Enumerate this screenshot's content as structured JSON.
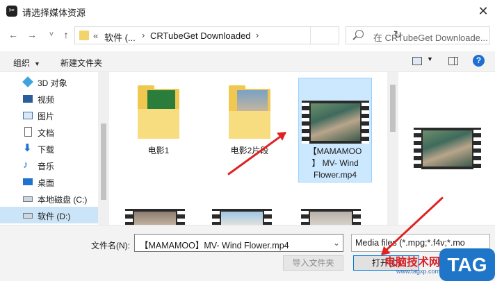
{
  "window": {
    "title": "请选择媒体资源",
    "app_icon_glyph": "✂"
  },
  "nav": {
    "back": "←",
    "forward": "→",
    "down": "˅",
    "up": "↑",
    "address": {
      "prefix": "«",
      "seg1": "软件 (...",
      "seg2": "CRTubeGet Downloaded",
      "chevron": "›"
    },
    "refresh": "↻",
    "search_placeholder": "在 CRTubeGet Downloade..."
  },
  "toolbar": {
    "organize": "组织",
    "new_folder": "新建文件夹",
    "caret": "▼",
    "help": "?"
  },
  "sidebar": {
    "items": [
      {
        "label": "3D 对象",
        "icon": "cube-3d-icon",
        "color": "#3fa3e0"
      },
      {
        "label": "视频",
        "icon": "video-icon",
        "color": "#2b5d9a"
      },
      {
        "label": "图片",
        "icon": "picture-icon",
        "color": "#3b6db3"
      },
      {
        "label": "文档",
        "icon": "document-icon",
        "color": "#6a6a6a"
      },
      {
        "label": "下载",
        "icon": "download-icon",
        "color": "#1f73d0"
      },
      {
        "label": "音乐",
        "icon": "music-icon",
        "color": "#1f73d0"
      },
      {
        "label": "桌面",
        "icon": "desktop-icon",
        "color": "#1f73d0"
      },
      {
        "label": "本地磁盘 (C:)",
        "icon": "drive-c-icon",
        "color": "#6b7b8b"
      },
      {
        "label": "软件 (D:)",
        "icon": "drive-d-icon",
        "color": "#6b7b8b"
      }
    ]
  },
  "files": [
    {
      "name": "电影1",
      "type": "folder"
    },
    {
      "name": "电影2片段",
      "type": "folder"
    },
    {
      "name_line1": "【MAMAMOO",
      "name_line2": "】 MV- Wind",
      "name_line3": "Flower.mp4",
      "type": "video"
    }
  ],
  "bottom": {
    "filename_label": "文件名(N):",
    "filename_value": "【MAMAMOO】MV- Wind Flower.mp4",
    "filetype_value": "Media files (*.mpg;*.f4v;*.mo",
    "import_button": "导入文件夹",
    "open_button": "打开(O)"
  },
  "watermark": {
    "text": "电脑技术网",
    "url": "www.tagxp.com",
    "tag": "TAG"
  },
  "colors": {
    "selection": "#cce8ff",
    "annotation_arrow": "#e02222",
    "accent": "#0078d7"
  }
}
